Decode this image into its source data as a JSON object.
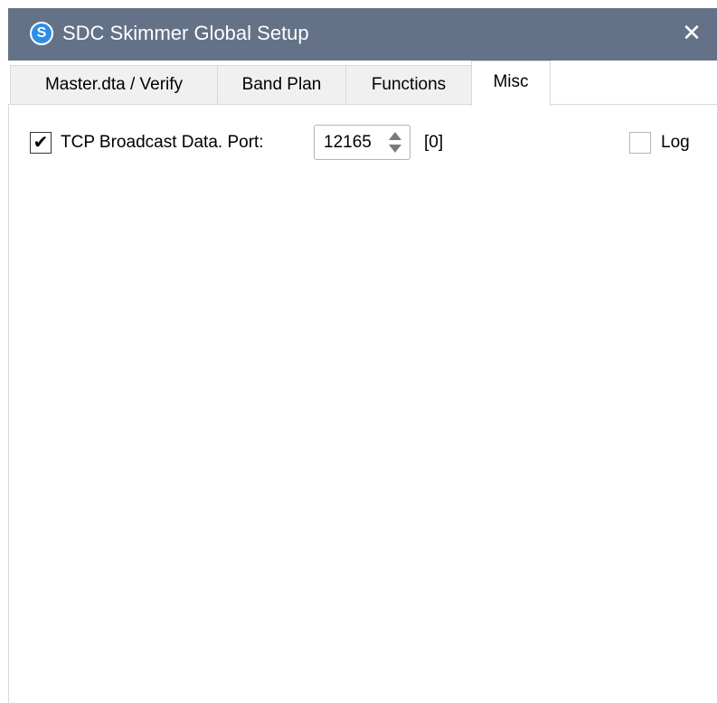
{
  "window": {
    "title": "SDC Skimmer Global Setup",
    "app_icon_glyph": "S",
    "close_glyph": "✕",
    "titlebar_color": "#647288"
  },
  "tabs": [
    {
      "label": "Master.dta / Verify",
      "active": false
    },
    {
      "label": "Band Plan",
      "active": false
    },
    {
      "label": "Functions",
      "active": false
    },
    {
      "label": "Misc",
      "active": true
    }
  ],
  "misc": {
    "tcp_broadcast": {
      "checked": true,
      "check_glyph": "✔",
      "label": "TCP Broadcast Data. Port:",
      "port_value": "12165",
      "connection_count": "[0]"
    },
    "log": {
      "checked": false,
      "label": "Log"
    }
  }
}
